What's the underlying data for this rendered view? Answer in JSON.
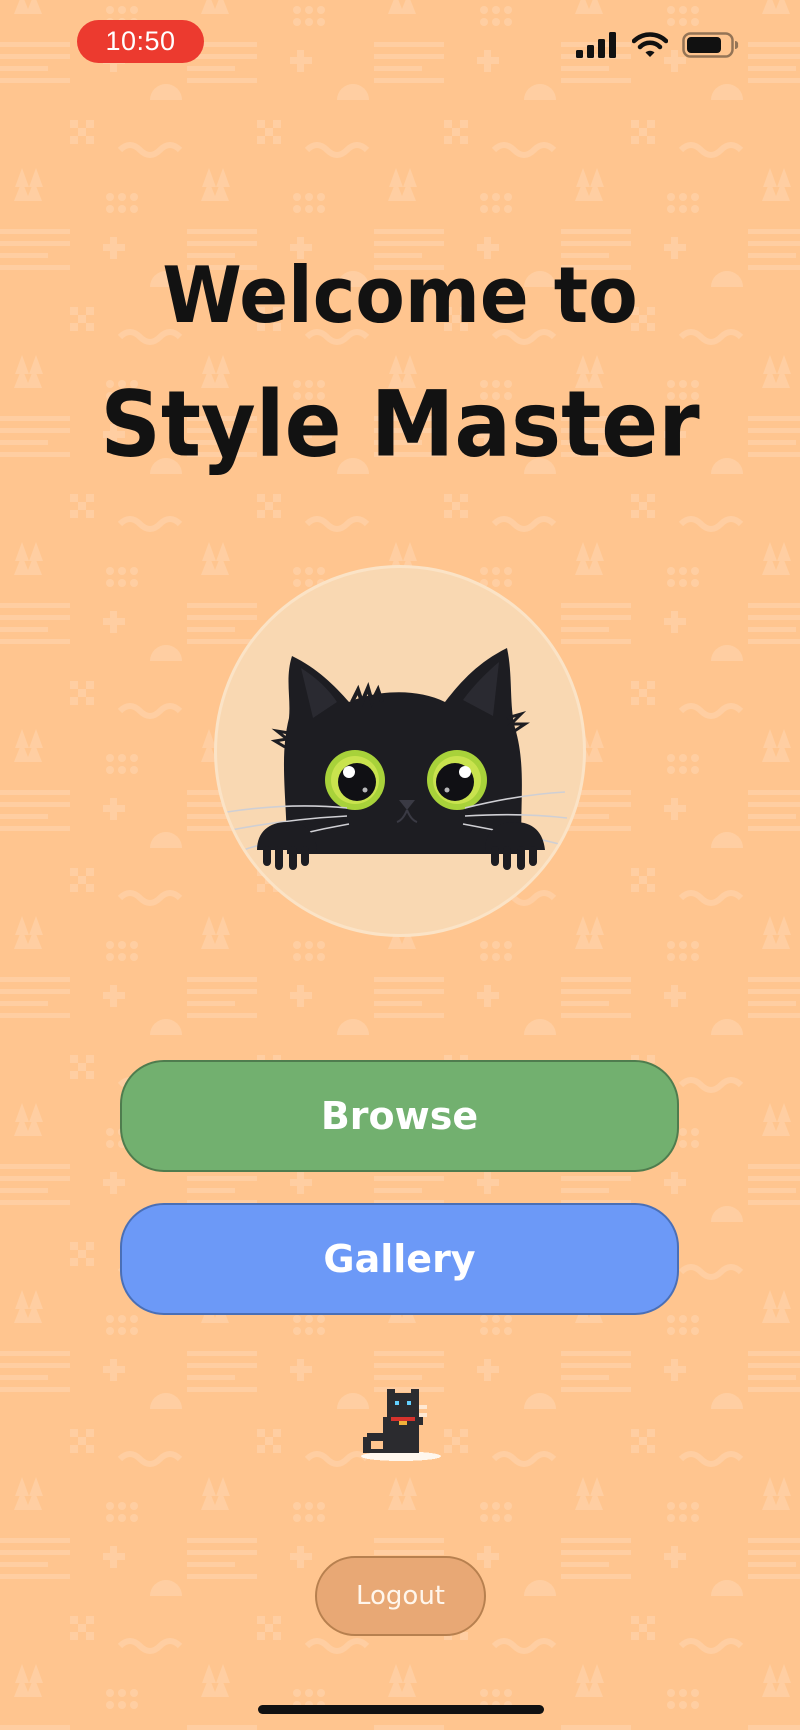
{
  "status_bar": {
    "time": "10:50",
    "icons": [
      "cellular-signal-icon",
      "wifi-icon",
      "battery-icon"
    ]
  },
  "welcome": {
    "line1": "Welcome to",
    "line2": "Style Master"
  },
  "avatar": {
    "icon": "black-cat-peeking-icon"
  },
  "buttons": {
    "browse": "Browse",
    "gallery": "Gallery",
    "logout": "Logout"
  },
  "mascot": {
    "icon": "pixel-cat-icon"
  },
  "colors": {
    "background": "#ffc58f",
    "browse": "#72b06f",
    "gallery": "#6c99f7",
    "logout": "#e8a875",
    "time_pill": "#ec3a2f"
  }
}
